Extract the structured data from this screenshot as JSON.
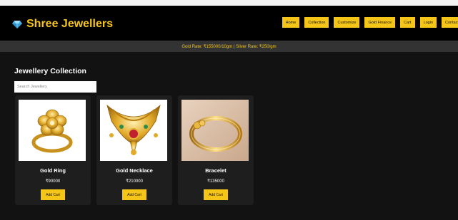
{
  "header": {
    "brand": "Shree Jewellers",
    "nav": [
      "Home",
      "Collection",
      "Customize",
      "Gold Finance",
      "Cart",
      "Login",
      "Contact"
    ]
  },
  "ticker": "Gold Rate: ₹155000/10gm | Silver Rate: ₹250/gm",
  "main": {
    "title": "Jewellery Collection",
    "search_placeholder": "Search Jewellery"
  },
  "products": [
    {
      "name": "Gold Ring",
      "price": "₹90000",
      "button": "Add Cart",
      "image": "gold-ring"
    },
    {
      "name": "Gold Necklace",
      "price": "₹210000",
      "button": "Add Cart",
      "image": "gold-necklace"
    },
    {
      "name": "Bracelet",
      "price": "₹135000",
      "button": "Add Cart",
      "image": "gold-bracelet"
    }
  ],
  "colors": {
    "accent": "#f5c518",
    "header_bg": "#000000",
    "page_bg": "#121212",
    "card_bg": "#1e1e1e",
    "ticker_bg": "#333333"
  }
}
